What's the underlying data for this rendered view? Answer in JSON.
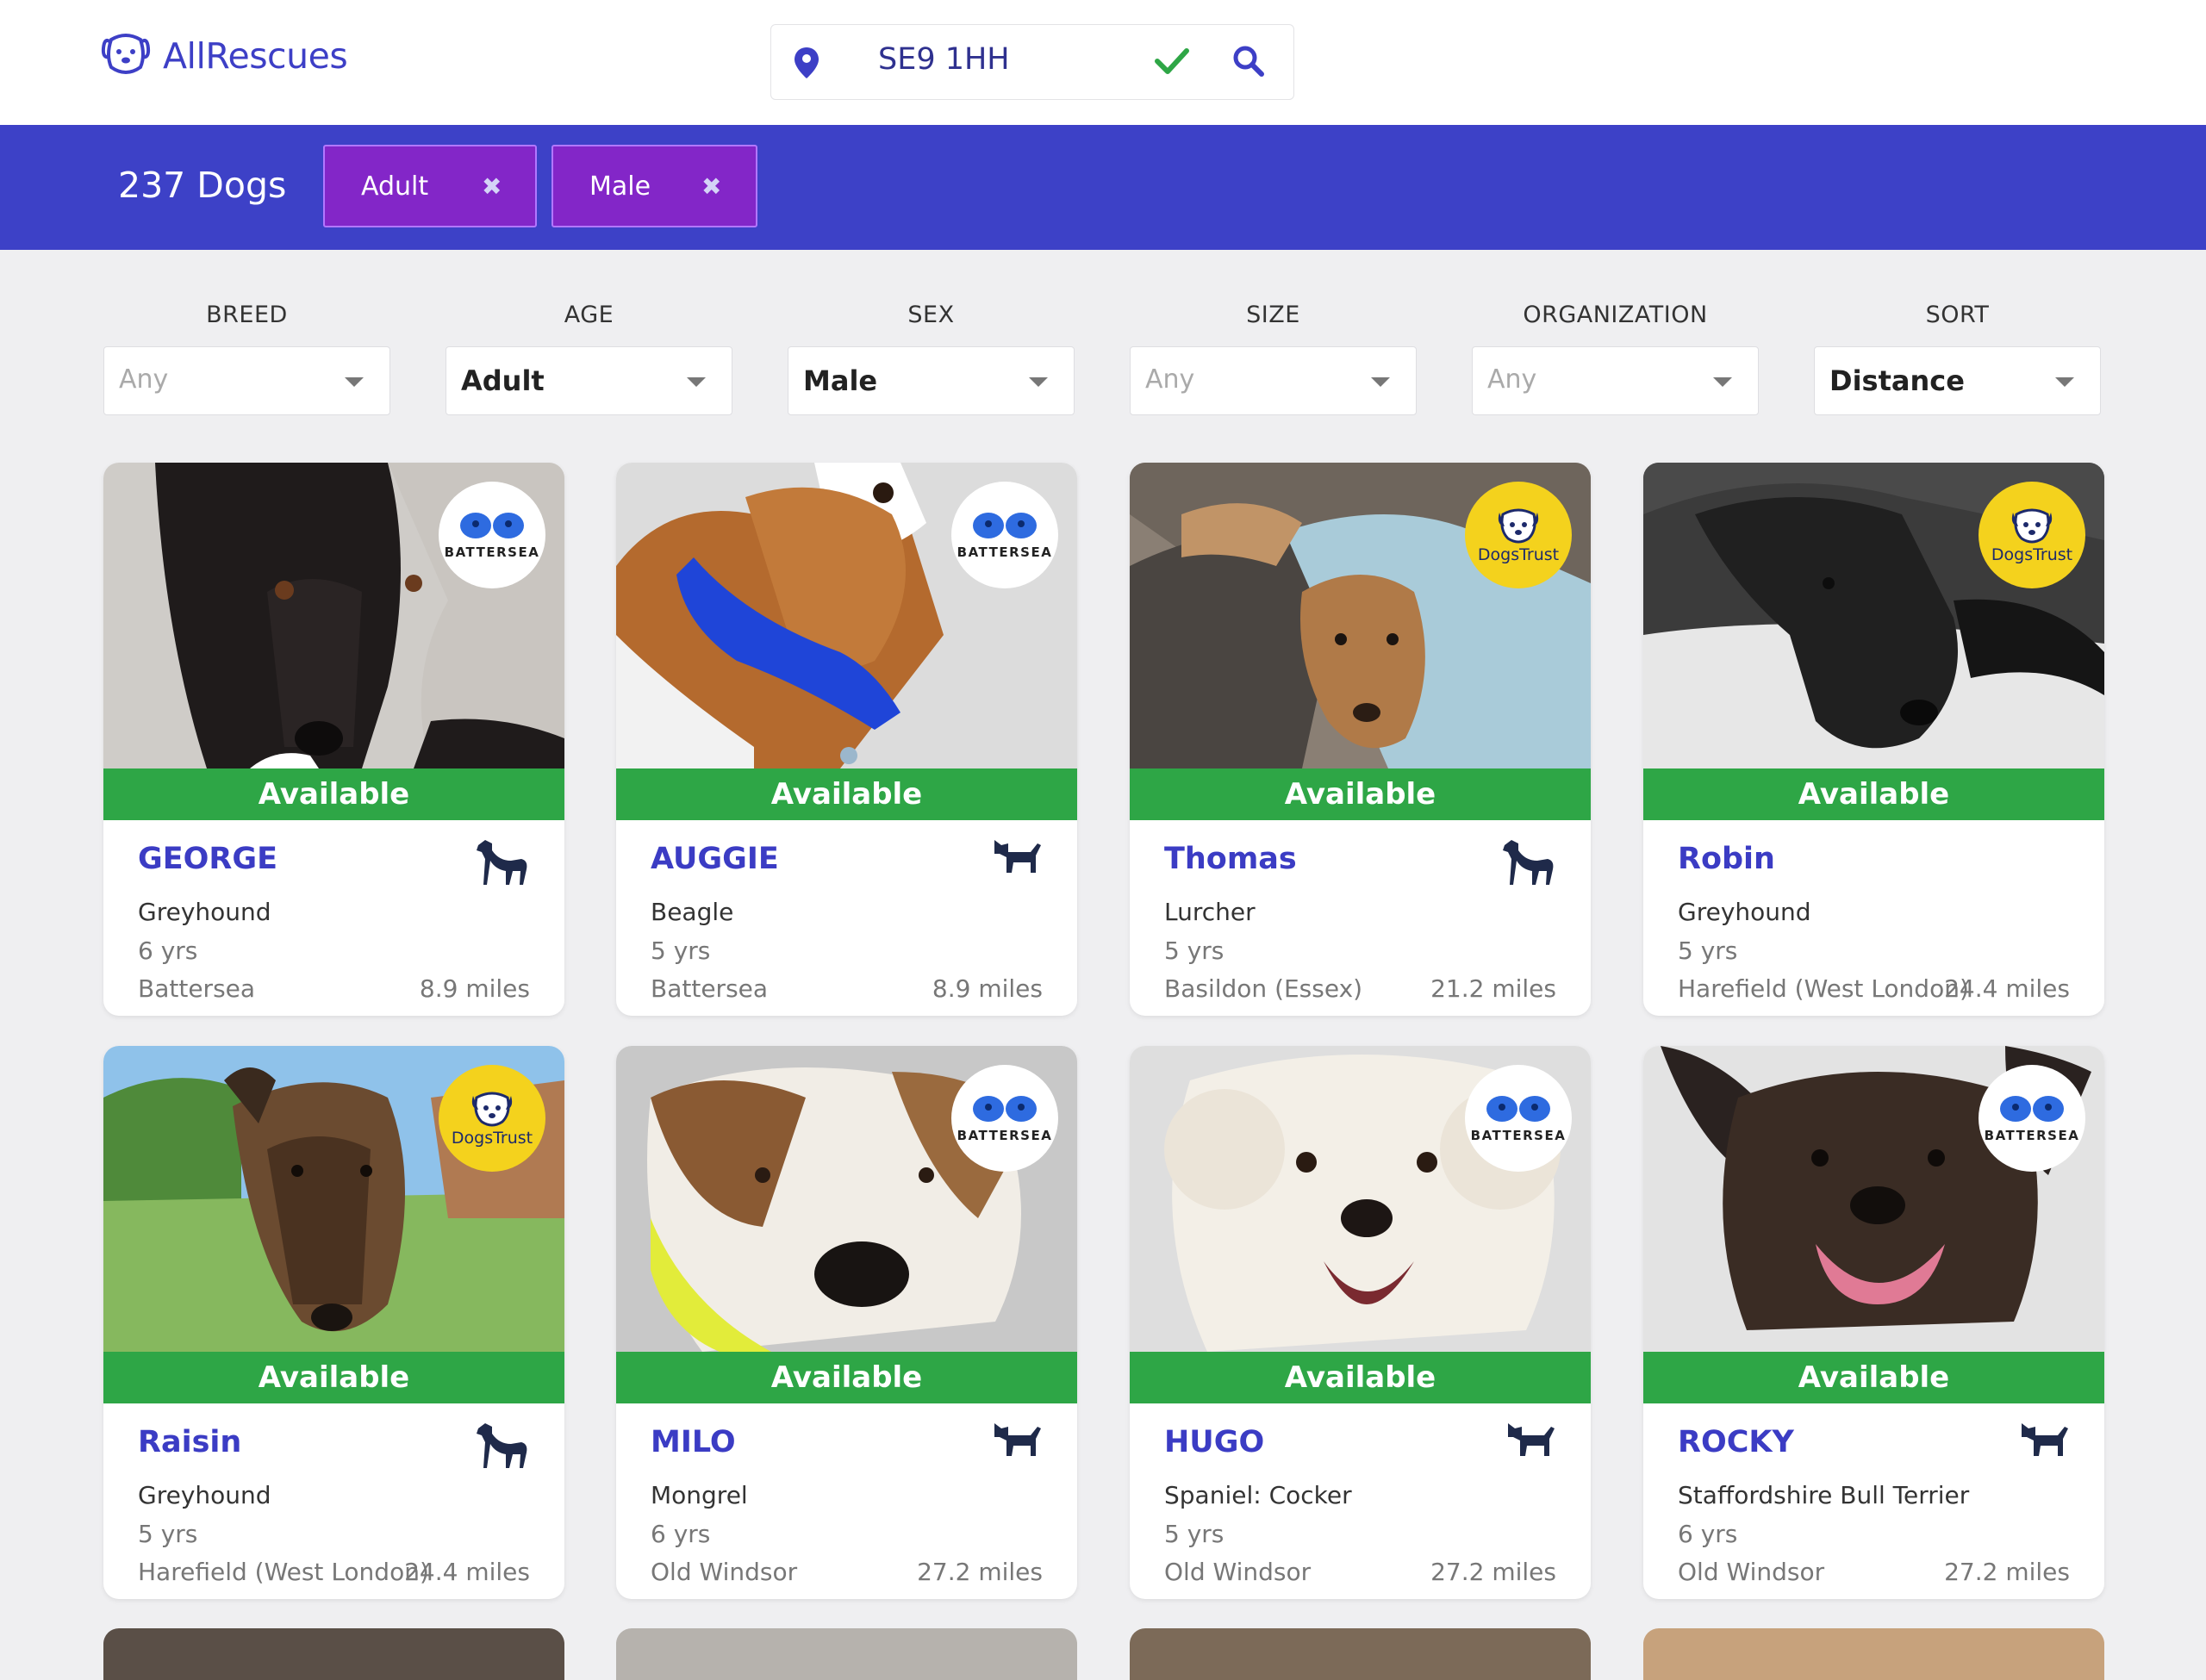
{
  "header": {
    "brand": "AllRescues",
    "postcode": "SE9 1HH"
  },
  "results": {
    "count_label": "237 Dogs",
    "chips": [
      {
        "label": "Adult"
      },
      {
        "label": "Male"
      }
    ]
  },
  "filters": [
    {
      "label": "BREED",
      "value": "Any",
      "is_set": false
    },
    {
      "label": "AGE",
      "value": "Adult",
      "is_set": true
    },
    {
      "label": "SEX",
      "value": "Male",
      "is_set": true
    },
    {
      "label": "SIZE",
      "value": "Any",
      "is_set": false
    },
    {
      "label": "ORGANIZATION",
      "value": "Any",
      "is_set": false
    },
    {
      "label": "SORT",
      "value": "Distance",
      "is_set": true
    }
  ],
  "badges": {
    "battersea": "BATTERSEA",
    "dogstrust": "DogsTrust"
  },
  "dogs": [
    {
      "name": "GEORGE",
      "status": "Available",
      "breed": "Greyhound",
      "age": "6 yrs",
      "location": "Battersea",
      "distance": "8.9 miles",
      "org": "battersea",
      "icon": "greyhound-icon"
    },
    {
      "name": "AUGGIE",
      "status": "Available",
      "breed": "Beagle",
      "age": "5 yrs",
      "location": "Battersea",
      "distance": "8.9 miles",
      "org": "battersea",
      "icon": "small-dog-icon"
    },
    {
      "name": "Thomas",
      "status": "Available",
      "breed": "Lurcher",
      "age": "5 yrs",
      "location": "Basildon (Essex)",
      "distance": "21.2 miles",
      "org": "dogstrust",
      "icon": "greyhound-icon"
    },
    {
      "name": "Robin",
      "status": "Available",
      "breed": "Greyhound",
      "age": "5 yrs",
      "location": "Harefield (West London)",
      "distance": "24.4 miles",
      "org": "dogstrust",
      "icon": "greyhound-icon"
    },
    {
      "name": "Raisin",
      "status": "Available",
      "breed": "Greyhound",
      "age": "5 yrs",
      "location": "Harefield (West London)",
      "distance": "24.4 miles",
      "org": "dogstrust",
      "icon": "greyhound-icon"
    },
    {
      "name": "MILO",
      "status": "Available",
      "breed": "Mongrel",
      "age": "6 yrs",
      "location": "Old Windsor",
      "distance": "27.2 miles",
      "org": "battersea",
      "icon": "small-dog-icon"
    },
    {
      "name": "HUGO",
      "status": "Available",
      "breed": "Spaniel: Cocker",
      "age": "5 yrs",
      "location": "Old Windsor",
      "distance": "27.2 miles",
      "org": "battersea",
      "icon": "small-dog-icon"
    },
    {
      "name": "ROCKY",
      "status": "Available",
      "breed": "Staffordshire Bull Terrier",
      "age": "6 yrs",
      "location": "Old Windsor",
      "distance": "27.2 miles",
      "org": "battersea",
      "icon": "small-dog-icon"
    }
  ],
  "colors": {
    "brand": "#3d3fc6",
    "results_bar": "#3d41c7",
    "chip": "#8326c8",
    "available": "#2ea646",
    "dogstrust_yellow": "#f4d21d"
  }
}
